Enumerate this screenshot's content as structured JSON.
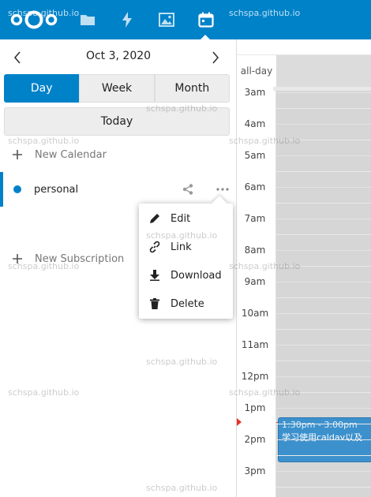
{
  "header": {
    "nav": [
      {
        "name": "files",
        "icon": "folder-icon"
      },
      {
        "name": "activity",
        "icon": "bolt-icon"
      },
      {
        "name": "photos",
        "icon": "image-icon"
      },
      {
        "name": "calendar",
        "icon": "calendar-icon",
        "active": true
      }
    ],
    "brand_color": "#0082c9"
  },
  "sidebar": {
    "date": "Oct 3, 2020",
    "views": [
      "Day",
      "Week",
      "Month"
    ],
    "active_view": "Day",
    "today_label": "Today",
    "new_calendar_label": "New Calendar",
    "calendar": {
      "name": "personal",
      "color": "#0082c9"
    },
    "new_subscription_label": "New Subscription"
  },
  "menu": {
    "items": [
      {
        "label": "Edit",
        "icon": "pencil-icon"
      },
      {
        "label": "Link",
        "icon": "link-icon"
      },
      {
        "label": "Download",
        "icon": "download-icon"
      },
      {
        "label": "Delete",
        "icon": "trash-icon"
      }
    ]
  },
  "grid": {
    "allday_label": "all-day",
    "hours": [
      "3am",
      "4am",
      "5am",
      "6am",
      "7am",
      "8am",
      "9am",
      "10am",
      "11am",
      "12pm",
      "1pm",
      "2pm",
      "3pm"
    ],
    "event": {
      "time": "1:30pm - 3:00pm",
      "title": "学习使用caldav以及",
      "color": "#3c91cd"
    },
    "now_indicator_color": "#e9322d"
  },
  "watermark": "schspa.github.io"
}
